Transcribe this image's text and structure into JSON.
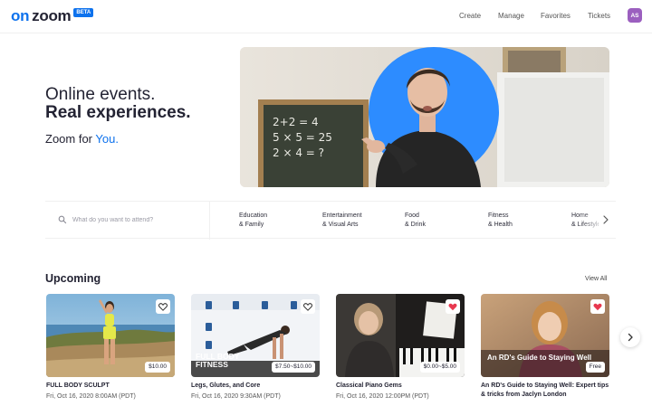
{
  "header": {
    "logo_on": "on",
    "logo_zoom": "zoom",
    "beta_badge": "BETA",
    "nav": [
      "Create",
      "Manage",
      "Favorites",
      "Tickets"
    ],
    "avatar_initials": "AS"
  },
  "hero": {
    "line1": "Online events.",
    "line2": "Real experiences.",
    "sub_prefix": "Zoom for ",
    "sub_highlight": "You.",
    "chalkboard": [
      "2+2 = 4",
      "5 × 5 = 25",
      "2 × 4 = ?"
    ]
  },
  "search": {
    "placeholder": "What do you want to attend?"
  },
  "categories": [
    {
      "line1": "Education",
      "line2": "& Family"
    },
    {
      "line1": "Entertainment",
      "line2": "& Visual Arts"
    },
    {
      "line1": "Food",
      "line2": "& Drink"
    },
    {
      "line1": "Fitness",
      "line2": "& Health"
    },
    {
      "line1": "Home",
      "line2": "& Lifestyle"
    }
  ],
  "upcoming": {
    "title": "Upcoming",
    "view_all": "View All",
    "cards": [
      {
        "title": "FULL BODY SCULPT",
        "date": "Fri, Oct 16, 2020 8:00AM (PDT)",
        "price": "$10.00",
        "favorited": false
      },
      {
        "title": "Legs, Glutes, and Core",
        "date": "Fri, Oct 16, 2020 9:30AM (PDT)",
        "price": "$7.50~$10.00",
        "favorited": false,
        "overlay_text": "FULL BODY FITNESS"
      },
      {
        "title": "Classical Piano Gems",
        "date": "Fri, Oct 16, 2020 12:00PM (PDT)",
        "price": "$0.00~$5.00",
        "favorited": true
      },
      {
        "title": "An RD's Guide to Staying Well: Expert tips & tricks from Jaclyn London",
        "date": "",
        "price": "Free",
        "favorited": true,
        "overlay_text": "An RD's Guide to Staying Well"
      }
    ]
  },
  "colors": {
    "brand_blue": "#0e72ed",
    "text_dark": "#232333",
    "avatar": "#9b5fbf",
    "heart_active": "#e8384f"
  },
  "icons": {
    "search": "search-icon",
    "heart": "heart-icon",
    "chevron": "chevron-right-icon"
  }
}
